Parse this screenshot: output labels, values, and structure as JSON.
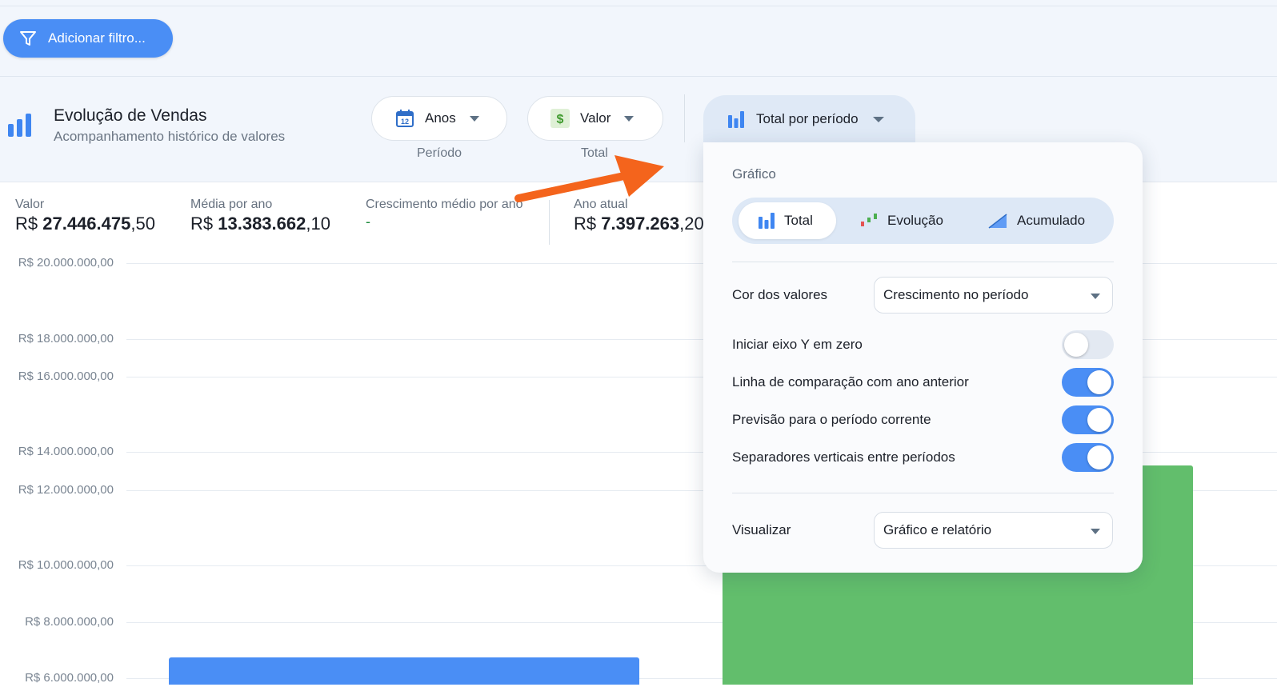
{
  "filter": {
    "label": "Adicionar filtro..."
  },
  "header": {
    "title": "Evolução de Vendas",
    "subtitle": "Acompanhamento histórico de valores"
  },
  "selectors": {
    "period": {
      "value": "Anos",
      "caption": "Período"
    },
    "metric": {
      "value": "Valor",
      "caption": "Total"
    },
    "chart_mode": {
      "value": "Total por período"
    }
  },
  "stats": [
    {
      "label": "Valor",
      "prefix": "R$ ",
      "bold": "27.446.475",
      "suffix": ",50"
    },
    {
      "label": "Média por ano",
      "prefix": "R$ ",
      "bold": "13.383.662",
      "suffix": ",10"
    },
    {
      "label": "Crescimento médio por ano",
      "value": "-"
    },
    {
      "label": "Ano atual",
      "prefix": "R$ ",
      "bold": "7.397.263",
      "suffix": ",20"
    }
  ],
  "popup": {
    "heading": "Gráfico",
    "segments": [
      "Total",
      "Evolução",
      "Acumulado"
    ],
    "active_segment": "Total",
    "color_label": "Cor dos valores",
    "color_value": "Crescimento no período",
    "toggles": [
      {
        "label": "Iniciar eixo Y em zero",
        "on": false
      },
      {
        "label": "Linha de comparação com ano anterior",
        "on": true
      },
      {
        "label": "Previsão para o período corrente",
        "on": true
      },
      {
        "label": "Separadores verticais entre períodos",
        "on": true
      }
    ],
    "view_label": "Visualizar",
    "view_value": "Gráfico e relatório"
  },
  "colors": {
    "accent": "#4a8ef5",
    "bar_blue": "#4a8ef5",
    "bar_green": "#62be6c",
    "arrow": "#f4641c"
  },
  "chart_data": {
    "type": "bar",
    "y_tick_labels": [
      "R$ 20.000.000,00",
      "R$ 18.000.000,00",
      "R$ 16.000.000,00",
      "R$ 14.000.000,00",
      "R$ 12.000.000,00",
      "R$ 10.000.000,00",
      "R$ 8.000.000,00",
      "R$ 6.000.000,00"
    ],
    "values": [
      6700000,
      11700000
    ],
    "bar_colors": [
      "#4a8ef5",
      "#62be6c"
    ],
    "grid": true
  }
}
